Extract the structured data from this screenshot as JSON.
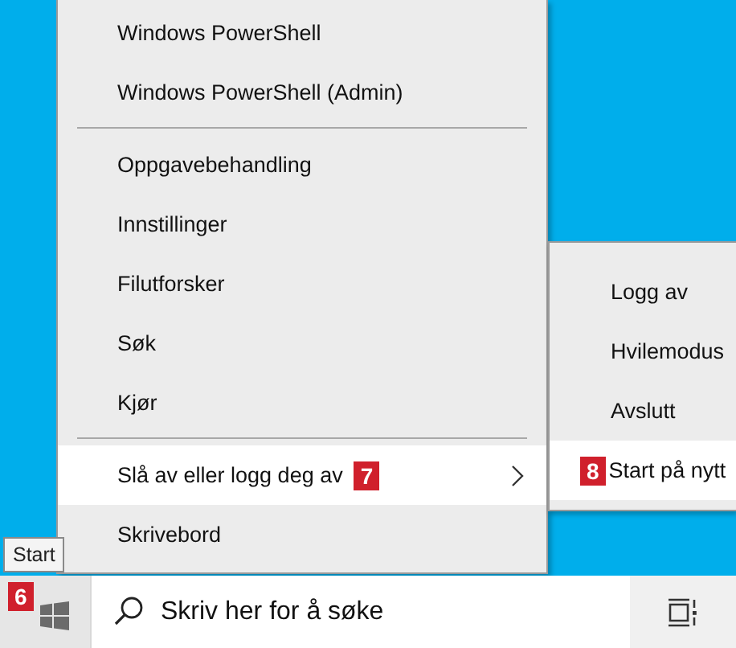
{
  "menu": {
    "items": [
      {
        "kind": "item",
        "label": "Windows PowerShell",
        "highlighted": false,
        "submenu": false
      },
      {
        "kind": "item",
        "label": "Windows PowerShell (Admin)",
        "highlighted": false,
        "submenu": false
      },
      {
        "kind": "separator"
      },
      {
        "kind": "item",
        "label": "Oppgavebehandling",
        "highlighted": false,
        "submenu": false
      },
      {
        "kind": "item",
        "label": "Innstillinger",
        "highlighted": false,
        "submenu": false
      },
      {
        "kind": "item",
        "label": "Filutforsker",
        "highlighted": false,
        "submenu": false
      },
      {
        "kind": "item",
        "label": "Søk",
        "highlighted": false,
        "submenu": false
      },
      {
        "kind": "item",
        "label": "Kjør",
        "highlighted": false,
        "submenu": false
      },
      {
        "kind": "separator"
      },
      {
        "kind": "item",
        "label": "Slå av eller logg deg av",
        "highlighted": true,
        "submenu": true,
        "badge": "7"
      },
      {
        "kind": "item",
        "label": "Skrivebord",
        "highlighted": false,
        "submenu": false
      }
    ]
  },
  "submenu": {
    "items": [
      {
        "label": "Logg av",
        "highlighted": false
      },
      {
        "label": "Hvilemodus",
        "highlighted": false
      },
      {
        "label": "Avslutt",
        "highlighted": false
      },
      {
        "label": "Start på nytt",
        "highlighted": true,
        "badge": "8"
      }
    ]
  },
  "tooltip": "Start",
  "taskbar": {
    "start_badge": "6",
    "search": {
      "placeholder": "Skriv her for å søke"
    }
  }
}
